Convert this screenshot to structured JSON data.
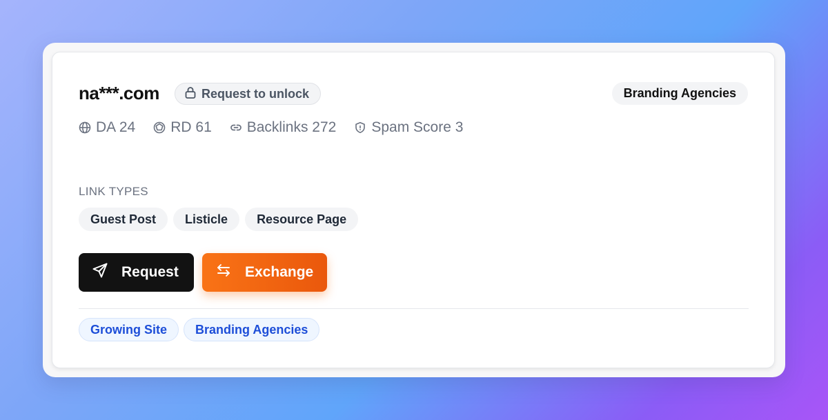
{
  "site": {
    "domain": "na***.com",
    "unlock_label": "Request to unlock",
    "category": "Branding Agencies"
  },
  "metrics": [
    {
      "label": "DA 24",
      "icon": "globe-icon"
    },
    {
      "label": "RD 61",
      "icon": "network-icon"
    },
    {
      "label": "Backlinks 272",
      "icon": "link-icon"
    },
    {
      "label": "Spam Score 3",
      "icon": "shield-icon"
    }
  ],
  "link_types": {
    "label": "LINK TYPES",
    "items": [
      "Guest Post",
      "Listicle",
      "Resource Page"
    ]
  },
  "actions": {
    "request_label": "Request",
    "exchange_label": "Exchange"
  },
  "tags": [
    "Growing Site",
    "Branding Agencies"
  ],
  "colors": {
    "primary_dark": "#121212",
    "accent_orange": "#f97316",
    "tag_blue": "#1d4ed8"
  }
}
